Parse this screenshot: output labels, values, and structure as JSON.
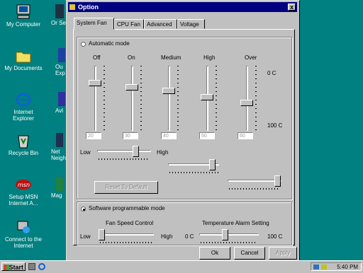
{
  "desktop": {
    "icons": [
      {
        "label": "My Computer"
      },
      {
        "label": "My Documents"
      },
      {
        "label": "Internet Explorer"
      },
      {
        "label": "Recycle Bin"
      },
      {
        "label": "Setup MSN Internet A..."
      },
      {
        "label": "Connect to the Internet"
      }
    ],
    "partial_icons": [
      {
        "label": "Or Ser"
      },
      {
        "label": "Ou Exp"
      },
      {
        "label": "Avl"
      },
      {
        "label": "Net Neigh"
      },
      {
        "label": "Mag"
      }
    ]
  },
  "taskbar": {
    "start_label": "Start",
    "clock": "5:40 PM"
  },
  "dialog": {
    "title": "Option",
    "close_glyph": "x",
    "tabs": [
      {
        "label": "System Fan",
        "active": true
      },
      {
        "label": "CPU Fan",
        "active": false
      },
      {
        "label": "Advanced",
        "active": false
      },
      {
        "label": "Voltage",
        "active": false
      }
    ],
    "automatic": {
      "mode_label": "Automatic mode",
      "selected": false,
      "levels": [
        {
          "label": "Off",
          "value": "20"
        },
        {
          "label": "On",
          "value": "30"
        },
        {
          "label": "Medium",
          "value": "40"
        },
        {
          "label": "High",
          "value": "50"
        },
        {
          "label": "Over",
          "value": "60"
        }
      ],
      "scale_top": "0 C",
      "scale_bottom": "100 C",
      "low_label": "Low",
      "high_label": "High",
      "reset_label": "Reset To Default"
    },
    "software": {
      "mode_label": "Software programmable mode",
      "selected": true,
      "fan_speed_title": "Fan Speed Control",
      "fan_low": "Low",
      "fan_high": "High",
      "alarm_title": "Temperature Alarm Setting",
      "alarm_min": "0 C",
      "alarm_max": "100 C"
    },
    "buttons": {
      "ok": "Ok",
      "cancel": "Cancel",
      "apply": "Apply"
    }
  }
}
